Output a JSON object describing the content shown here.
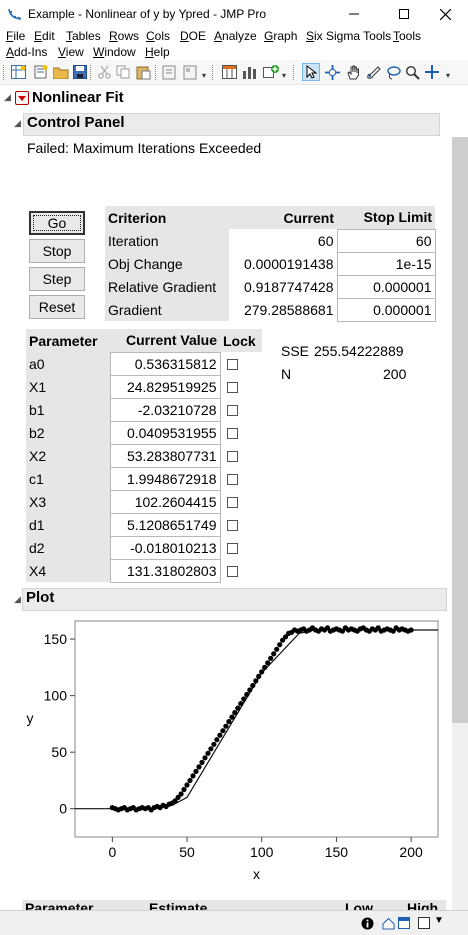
{
  "window": {
    "title": "Example - Nonlinear of y by Ypred - JMP Pro"
  },
  "menu": [
    {
      "label": "File",
      "ul": "F",
      "rest": "ile"
    },
    {
      "label": "Edit",
      "ul": "E",
      "rest": "dit"
    },
    {
      "label": "Tables",
      "ul": "T",
      "rest": "ables"
    },
    {
      "label": "Rows",
      "ul": "R",
      "rest": "ows"
    },
    {
      "label": "Cols",
      "ul": "C",
      "rest": "ols"
    },
    {
      "label": "DOE",
      "ul": "D",
      "rest": "OE"
    },
    {
      "label": "Analyze",
      "ul": "A",
      "rest": "nalyze"
    },
    {
      "label": "Graph",
      "ul": "G",
      "rest": "raph"
    },
    {
      "label": "Six Sigma Tools",
      "ul": "S",
      "rest": "ix Sigma Tools"
    },
    {
      "label": "Tools",
      "ul": "T",
      "rest": "ools"
    },
    {
      "label": "Add-Ins",
      "ul": "A",
      "rest": "dd-Ins"
    },
    {
      "label": "View",
      "ul": "V",
      "rest": "iew"
    },
    {
      "label": "Window",
      "ul": "W",
      "rest": "indow"
    },
    {
      "label": "Help",
      "ul": "H",
      "rest": "elp"
    }
  ],
  "report": {
    "title": "Nonlinear Fit",
    "control_panel": {
      "title": "Control Panel",
      "status": "Failed: Maximum Iterations Exceeded",
      "buttons": {
        "go": "Go",
        "stop": "Stop",
        "step": "Step",
        "reset": "Reset"
      },
      "criteria": {
        "headers": [
          "Criterion",
          "Current",
          "Stop Limit"
        ],
        "rows": [
          {
            "criterion": "Iteration",
            "current": "60",
            "limit": "60"
          },
          {
            "criterion": "Obj Change",
            "current": "0.0000191438",
            "limit": "1e-15"
          },
          {
            "criterion": "Relative Gradient",
            "current": "0.9187747428",
            "limit": "0.000001"
          },
          {
            "criterion": "Gradient",
            "current": "279.28588681",
            "limit": "0.000001"
          }
        ]
      },
      "parameters": {
        "headers": [
          "Parameter",
          "Current Value",
          "Lock"
        ],
        "rows": [
          {
            "name": "a0",
            "value": "0.536315812"
          },
          {
            "name": "X1",
            "value": "24.829519925"
          },
          {
            "name": "b1",
            "value": "-2.03210728"
          },
          {
            "name": "b2",
            "value": "0.0409531955"
          },
          {
            "name": "X2",
            "value": "53.283807731"
          },
          {
            "name": "c1",
            "value": "1.9948672918"
          },
          {
            "name": "X3",
            "value": "102.2604415"
          },
          {
            "name": "d1",
            "value": "5.1208651749"
          },
          {
            "name": "d2",
            "value": "-0.018010213"
          },
          {
            "name": "X4",
            "value": "131.31802803"
          }
        ]
      },
      "sse_label": "SSE",
      "sse_value": "255.54222889",
      "n_label": "N",
      "n_value": "200"
    },
    "plot": {
      "title": "Plot"
    },
    "estimates_headers": {
      "parameter": "Parameter",
      "estimate": "Estimate",
      "low": "Low",
      "high": "High"
    }
  },
  "chart_data": {
    "type": "scatter",
    "xlabel": "x",
    "ylabel": "y",
    "xlim": [
      -25,
      218
    ],
    "ylim": [
      -25,
      166
    ],
    "xticks": [
      0,
      50,
      100,
      150,
      200
    ],
    "yticks": [
      0,
      50,
      100,
      150
    ],
    "grid": false,
    "series": [
      {
        "x": [
          0,
          2,
          4,
          6,
          8,
          10,
          12,
          14,
          16,
          18,
          20,
          22,
          24,
          26,
          28,
          30,
          32,
          34,
          36,
          38,
          40,
          42,
          44,
          46,
          48,
          50,
          52,
          54,
          56,
          58,
          60,
          62,
          64,
          66,
          68,
          70,
          72,
          74,
          76,
          78,
          80,
          82,
          84,
          86,
          88,
          90,
          92,
          94,
          96,
          98,
          100,
          102,
          104,
          106,
          108,
          110,
          112,
          114,
          116,
          118,
          120,
          122,
          124,
          126,
          128,
          130,
          132,
          134,
          136,
          138,
          140,
          142,
          144,
          146,
          148,
          150,
          152,
          154,
          156,
          158,
          160,
          162,
          164,
          166,
          168,
          170,
          172,
          174,
          176,
          178,
          180,
          182,
          184,
          186,
          188,
          190,
          192,
          194,
          196,
          198,
          200
        ],
        "y": [
          1,
          0,
          -1,
          0,
          1,
          -1,
          0,
          1,
          -1,
          0,
          1,
          0,
          1,
          -1,
          1,
          2,
          1,
          3,
          2,
          4,
          5,
          7,
          10,
          13,
          17,
          21,
          25,
          29,
          33,
          37,
          41,
          45,
          49,
          53,
          57,
          61,
          65,
          69,
          73,
          77,
          81,
          85,
          89,
          93,
          97,
          101,
          105,
          109,
          113,
          117,
          121,
          125,
          129,
          133,
          137,
          141,
          145,
          149,
          152,
          155,
          156,
          158,
          157,
          158,
          159,
          157,
          158,
          160,
          158,
          157,
          159,
          158,
          160,
          157,
          158,
          159,
          158,
          157,
          160,
          158,
          159,
          158,
          157,
          159,
          160,
          158,
          157,
          159,
          158,
          160,
          157,
          158,
          159,
          158,
          157,
          160,
          158,
          159,
          158,
          157,
          158
        ]
      }
    ],
    "fit_line": {
      "x": [
        -25,
        0,
        25,
        40,
        50,
        100,
        125,
        135,
        218
      ],
      "y": [
        0,
        0,
        0,
        3,
        10,
        120,
        155,
        158,
        158
      ]
    }
  },
  "toolbar_icons": [
    "new-data-table-icon",
    "new-script-icon",
    "open-icon",
    "save-icon",
    "cut-icon",
    "copy-icon",
    "paste-icon",
    "journal-icon",
    "layout-icon",
    "data-grid-icon",
    "bar-chart-icon",
    "add-icon",
    "arrow-tool-icon",
    "crosshair-tool-icon",
    "hand-tool-icon",
    "lasso-tool-icon",
    "brush-tool-icon",
    "magnifier-tool-icon",
    "zoom-tool-icon",
    "plus-tool-icon"
  ]
}
